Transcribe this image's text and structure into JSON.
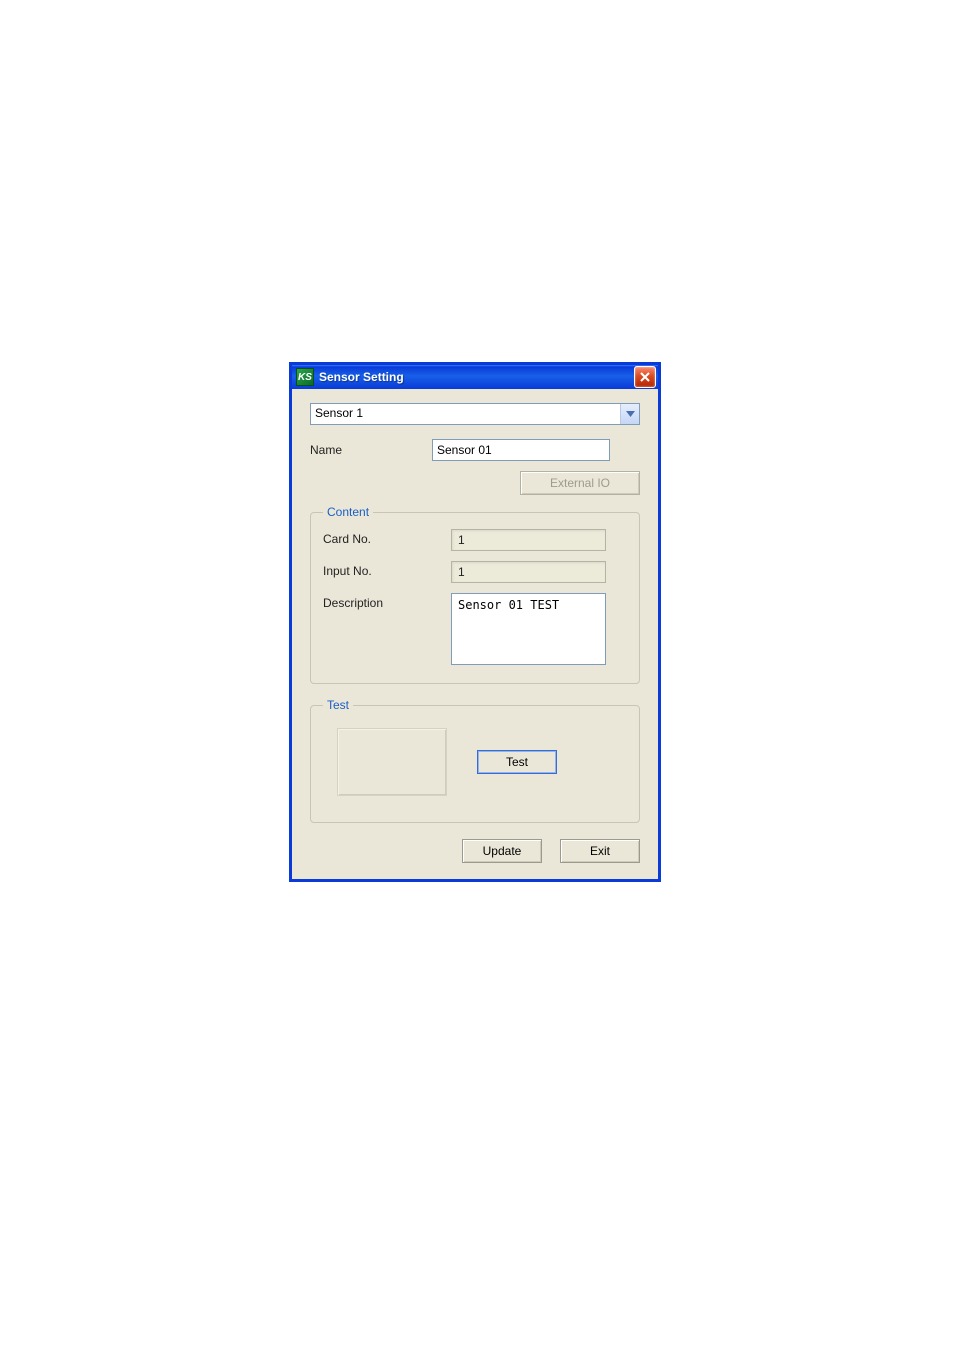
{
  "window": {
    "title": "Sensor Setting",
    "icon_label": "KS"
  },
  "selector": {
    "selected": "Sensor 1"
  },
  "form": {
    "name_label": "Name",
    "name_value": "Sensor 01",
    "external_io_label": "External IO"
  },
  "content": {
    "legend": "Content",
    "card_no_label": "Card No.",
    "card_no_value": "1",
    "input_no_label": "Input No.",
    "input_no_value": "1",
    "description_label": "Description",
    "description_value": "Sensor 01 TEST"
  },
  "test": {
    "legend": "Test",
    "test_button_label": "Test"
  },
  "footer": {
    "update_label": "Update",
    "exit_label": "Exit"
  }
}
